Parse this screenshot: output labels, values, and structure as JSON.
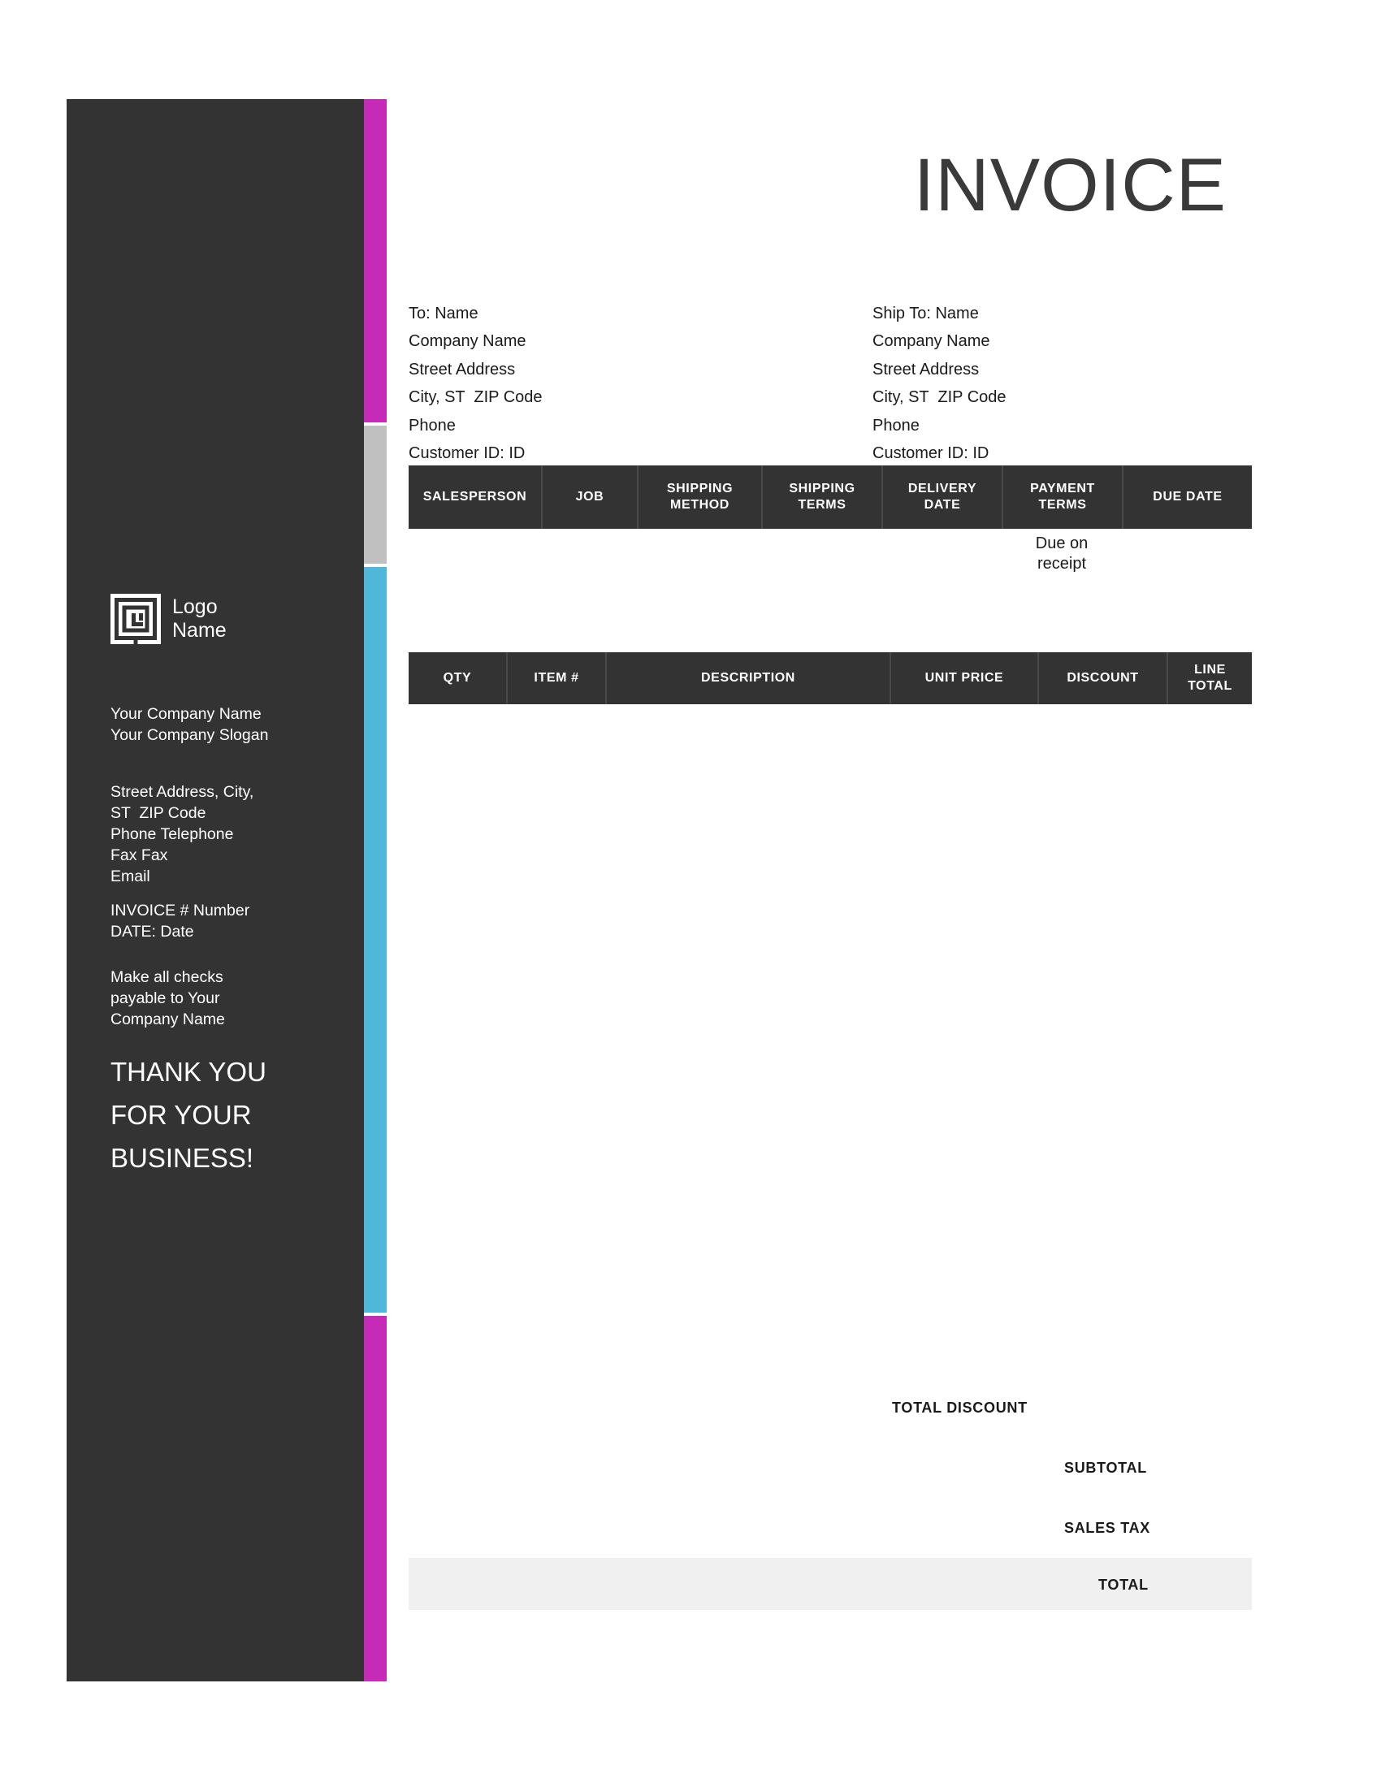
{
  "document": {
    "title": "INVOICE"
  },
  "colors": {
    "sidebar_bg": "#333333",
    "accent_magenta": "#C62BB8",
    "accent_gray": "#C0C0C0",
    "accent_cyan": "#4FB8D8",
    "table_header_bg": "#333333",
    "total_band_bg": "#F0F0F0",
    "text_dark": "#1A1A1A",
    "text_light": "#FFFFFF"
  },
  "sidebar": {
    "logo": {
      "icon": "maze-square-logo-icon",
      "label": "Logo\nName"
    },
    "company_name": "Your Company Name",
    "company_slogan": "Your Company Slogan",
    "address_lines": [
      "Street Address, City,",
      "ST  ZIP Code",
      "Phone Telephone",
      "Fax Fax",
      "Email"
    ],
    "invoice_number_line": "INVOICE # Number",
    "invoice_date_line": "DATE: Date",
    "checks_note": "Make all checks\npayable to Your\nCompany Name",
    "thank_you": "THANK YOU\nFOR YOUR\nBUSINESS!"
  },
  "bill_to": {
    "lines": [
      "To: Name",
      "Company Name",
      "Street Address",
      "City, ST  ZIP Code",
      "Phone",
      "Customer ID: ID"
    ]
  },
  "ship_to": {
    "lines": [
      "Ship To: Name",
      "Company Name",
      "Street Address",
      "City, ST  ZIP Code",
      "Phone",
      "Customer ID: ID"
    ]
  },
  "order_table": {
    "headers": [
      "SALESPERSON",
      "JOB",
      "SHIPPING\nMETHOD",
      "SHIPPING\nTERMS",
      "DELIVERY\nDATE",
      "PAYMENT\nTERMS",
      "DUE DATE"
    ],
    "values": [
      "",
      "",
      "",
      "",
      "",
      "Due on\nreceipt",
      ""
    ]
  },
  "items_table": {
    "headers": [
      "QTY",
      "ITEM #",
      "DESCRIPTION",
      "UNIT PRICE",
      "DISCOUNT",
      "LINE\nTOTAL"
    ],
    "rows": []
  },
  "totals": {
    "total_discount_label": "TOTAL DISCOUNT",
    "total_discount_value": "",
    "subtotal_label": "SUBTOTAL",
    "subtotal_value": "",
    "sales_tax_label": "SALES TAX",
    "sales_tax_value": "",
    "total_label": "TOTAL",
    "total_value": ""
  }
}
